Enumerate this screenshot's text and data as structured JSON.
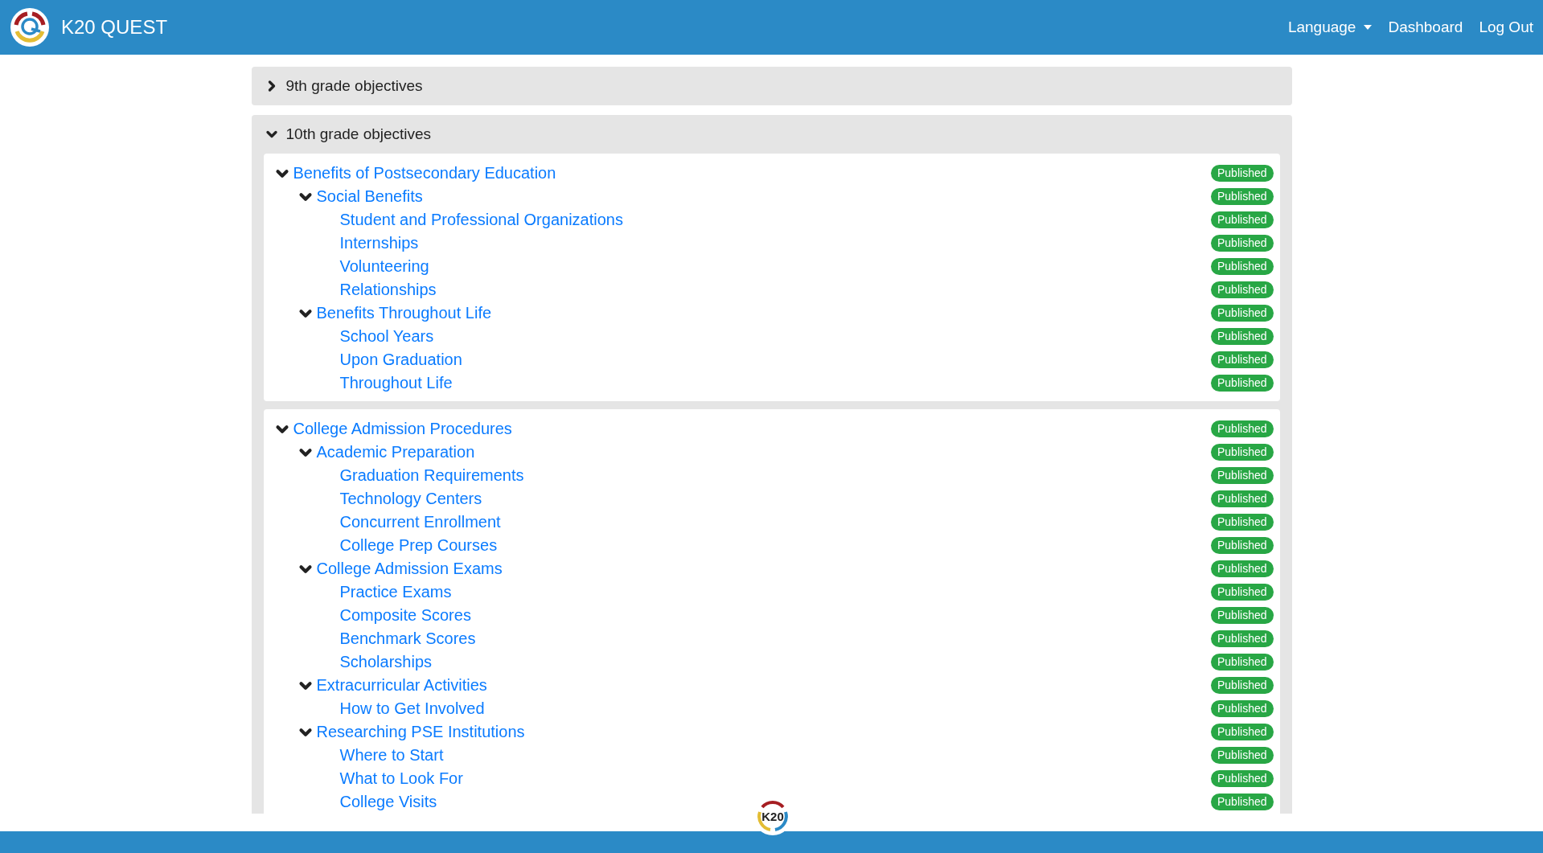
{
  "navbar": {
    "brand": "K20 QUEST",
    "links": [
      {
        "label": "Language",
        "kind": "dropdown"
      },
      {
        "label": "Dashboard",
        "kind": "link"
      },
      {
        "label": "Log Out",
        "kind": "link"
      }
    ]
  },
  "accordions": [
    {
      "title": "9th grade objectives",
      "expanded": false
    },
    {
      "title": "10th grade objectives",
      "expanded": true,
      "cards": [
        {
          "items": [
            {
              "label": "Benefits of Postsecondary Education",
              "status": "Published",
              "expanded": true,
              "children": [
                {
                  "label": "Social Benefits",
                  "status": "Published",
                  "expanded": true,
                  "children": [
                    {
                      "label": "Student and Professional Organizations",
                      "status": "Published"
                    },
                    {
                      "label": "Internships",
                      "status": "Published"
                    },
                    {
                      "label": "Volunteering",
                      "status": "Published"
                    },
                    {
                      "label": "Relationships",
                      "status": "Published"
                    }
                  ]
                },
                {
                  "label": "Benefits Throughout Life",
                  "status": "Published",
                  "expanded": true,
                  "children": [
                    {
                      "label": "School Years",
                      "status": "Published"
                    },
                    {
                      "label": "Upon Graduation",
                      "status": "Published"
                    },
                    {
                      "label": "Throughout Life",
                      "status": "Published"
                    }
                  ]
                }
              ]
            }
          ]
        },
        {
          "items": [
            {
              "label": "College Admission Procedures",
              "status": "Published",
              "expanded": true,
              "children": [
                {
                  "label": "Academic Preparation",
                  "status": "Published",
                  "expanded": true,
                  "children": [
                    {
                      "label": "Graduation Requirements",
                      "status": "Published"
                    },
                    {
                      "label": "Technology Centers",
                      "status": "Published"
                    },
                    {
                      "label": "Concurrent Enrollment",
                      "status": "Published"
                    },
                    {
                      "label": "College Prep Courses",
                      "status": "Published"
                    }
                  ]
                },
                {
                  "label": "College Admission Exams",
                  "status": "Published",
                  "expanded": true,
                  "children": [
                    {
                      "label": "Practice Exams",
                      "status": "Published"
                    },
                    {
                      "label": "Composite Scores",
                      "status": "Published"
                    },
                    {
                      "label": "Benchmark Scores",
                      "status": "Published"
                    },
                    {
                      "label": "Scholarships",
                      "status": "Published"
                    }
                  ]
                },
                {
                  "label": "Extracurricular Activities",
                  "status": "Published",
                  "expanded": true,
                  "children": [
                    {
                      "label": "How to Get Involved",
                      "status": "Published"
                    }
                  ]
                },
                {
                  "label": "Researching PSE Institutions",
                  "status": "Published",
                  "expanded": true,
                  "children": [
                    {
                      "label": "Where to Start",
                      "status": "Published"
                    },
                    {
                      "label": "What to Look For",
                      "status": "Published"
                    },
                    {
                      "label": "College Visits",
                      "status": "Published"
                    }
                  ]
                }
              ]
            }
          ]
        }
      ]
    }
  ],
  "footer": {
    "logo_text": "K20"
  }
}
